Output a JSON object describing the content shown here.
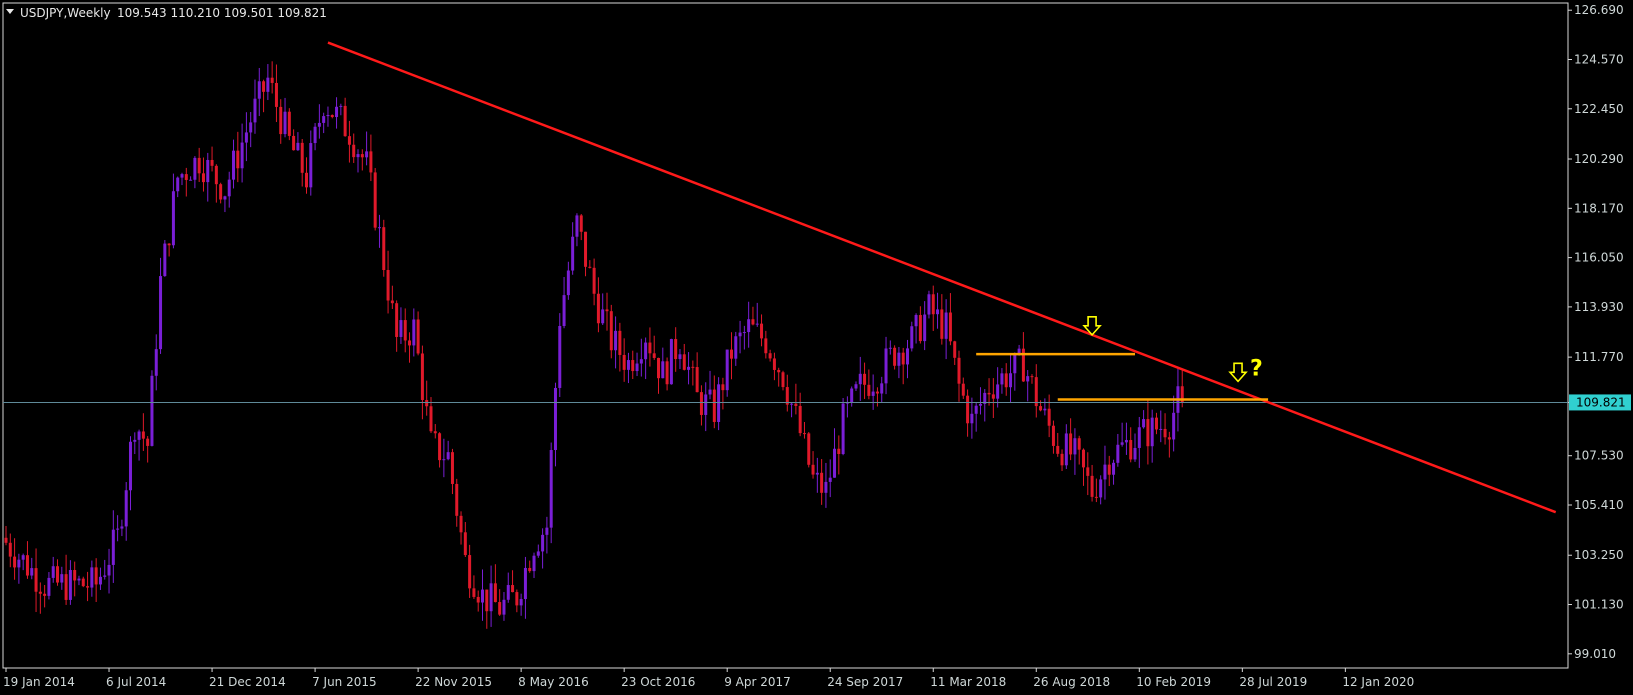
{
  "header": {
    "symbol": "USDJPY,Weekly",
    "ohlc": "109.543 110.210 109.501 109.821"
  },
  "colors": {
    "background": "#000000",
    "frame": "#d8d8d8",
    "bull": "#7a1fd6",
    "bear": "#e0192a",
    "trendline": "#ff1a1a",
    "support": "#ffa500",
    "price_line": "#5f8a99",
    "arrow": "#ffff00",
    "price_badge": "#30d0d0"
  },
  "chart_data": {
    "type": "candlestick",
    "ylim": [
      98.4,
      127.0
    ],
    "yticks": [
      "126.690",
      "124.570",
      "122.450",
      "120.290",
      "118.170",
      "116.050",
      "113.930",
      "111.770",
      "109.821",
      "107.530",
      "105.410",
      "103.250",
      "101.130",
      "99.010"
    ],
    "ytick_values": [
      126.69,
      124.57,
      122.45,
      120.29,
      118.17,
      116.05,
      113.93,
      111.77,
      109.821,
      107.53,
      105.41,
      103.25,
      101.13,
      99.01
    ],
    "xticks": [
      "19 Jan 2014",
      "6 Jul 2014",
      "21 Dec 2014",
      "7 Jun 2015",
      "22 Nov 2015",
      "8 May 2016",
      "23 Oct 2016",
      "9 Apr 2017",
      "24 Sep 2017",
      "11 Mar 2018",
      "26 Aug 2018",
      "10 Feb 2019",
      "28 Jul 2019",
      "12 Jan 2020"
    ],
    "current_price": "109.821",
    "price_anchors": [
      {
        "week": 0,
        "price": 104.0
      },
      {
        "week": 10,
        "price": 102.0
      },
      {
        "week": 22,
        "price": 102.0
      },
      {
        "week": 27,
        "price": 104.0
      },
      {
        "week": 31,
        "price": 109.0
      },
      {
        "week": 34,
        "price": 108.0
      },
      {
        "week": 37,
        "price": 115.0
      },
      {
        "week": 41,
        "price": 119.5
      },
      {
        "week": 46,
        "price": 120.3
      },
      {
        "week": 52,
        "price": 119.0
      },
      {
        "week": 58,
        "price": 122.0
      },
      {
        "week": 62,
        "price": 123.7
      },
      {
        "week": 67,
        "price": 121.0
      },
      {
        "week": 71,
        "price": 119.5
      },
      {
        "week": 75,
        "price": 122.8
      },
      {
        "week": 81,
        "price": 121.5
      },
      {
        "week": 85,
        "price": 120.0
      },
      {
        "week": 88,
        "price": 117.0
      },
      {
        "week": 92,
        "price": 112.5
      },
      {
        "week": 96,
        "price": 113.0
      },
      {
        "week": 100,
        "price": 108.0
      },
      {
        "week": 104,
        "price": 107.5
      },
      {
        "week": 108,
        "price": 103.0
      },
      {
        "week": 112,
        "price": 101.5
      },
      {
        "week": 116,
        "price": 101.0
      },
      {
        "week": 120,
        "price": 101.5
      },
      {
        "week": 124,
        "price": 103.8
      },
      {
        "week": 127,
        "price": 104.5
      },
      {
        "week": 130,
        "price": 113.5
      },
      {
        "week": 134,
        "price": 117.5
      },
      {
        "week": 138,
        "price": 114.5
      },
      {
        "week": 142,
        "price": 112.5
      },
      {
        "week": 146,
        "price": 111.5
      },
      {
        "week": 150,
        "price": 112.8
      },
      {
        "week": 154,
        "price": 111.0
      },
      {
        "week": 158,
        "price": 112.5
      },
      {
        "week": 162,
        "price": 110.0
      },
      {
        "week": 166,
        "price": 109.5
      },
      {
        "week": 170,
        "price": 112.0
      },
      {
        "week": 174,
        "price": 113.0
      },
      {
        "week": 178,
        "price": 112.5
      },
      {
        "week": 182,
        "price": 111.0
      },
      {
        "week": 186,
        "price": 108.5
      },
      {
        "week": 189,
        "price": 106.5
      },
      {
        "week": 192,
        "price": 106.0
      },
      {
        "week": 196,
        "price": 109.0
      },
      {
        "week": 200,
        "price": 110.5
      },
      {
        "week": 204,
        "price": 111.0
      },
      {
        "week": 208,
        "price": 112.0
      },
      {
        "week": 212,
        "price": 112.5
      },
      {
        "week": 216,
        "price": 113.8
      },
      {
        "week": 220,
        "price": 113.0
      },
      {
        "week": 223,
        "price": 110.5
      },
      {
        "week": 226,
        "price": 109.0
      },
      {
        "week": 230,
        "price": 110.5
      },
      {
        "week": 234,
        "price": 111.0
      },
      {
        "week": 238,
        "price": 111.5
      },
      {
        "week": 242,
        "price": 109.5
      },
      {
        "week": 246,
        "price": 108.0
      },
      {
        "week": 250,
        "price": 107.5
      },
      {
        "week": 254,
        "price": 106.0
      },
      {
        "week": 258,
        "price": 107.5
      },
      {
        "week": 262,
        "price": 108.0
      },
      {
        "week": 266,
        "price": 108.5
      },
      {
        "week": 270,
        "price": 108.8
      },
      {
        "week": 272,
        "price": 109.0
      },
      {
        "week": 274,
        "price": 109.821
      }
    ],
    "trendline": {
      "from": {
        "week": 75,
        "price": 125.3
      },
      "to": {
        "week": 361,
        "price": 105.1
      }
    },
    "support_lines": [
      {
        "from_week": 226,
        "to_week": 263,
        "price": 111.9
      },
      {
        "from_week": 245,
        "to_week": 294,
        "price": 109.95
      }
    ],
    "arrows": [
      {
        "week": 253,
        "price": 112.9,
        "label": ""
      },
      {
        "week": 287,
        "price": 110.9,
        "label": "?"
      }
    ]
  }
}
